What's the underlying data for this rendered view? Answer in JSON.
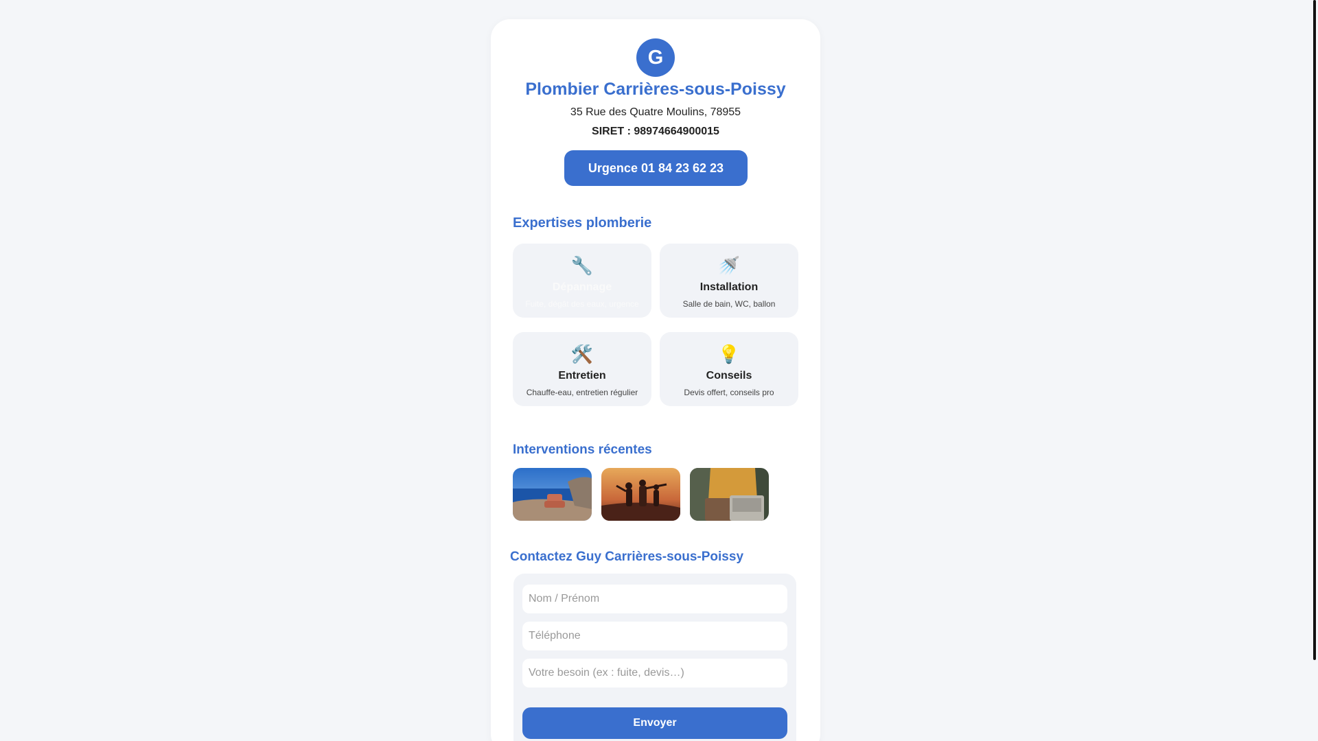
{
  "header": {
    "logo_letter": "G",
    "title": "Plombier Carrières-sous-Poissy",
    "address": "35 Rue des Quatre Moulins, 78955",
    "siret": "SIRET : 98974664900015",
    "urgent_button": "Urgence 01 84 23 62 23"
  },
  "services": {
    "section_title": "Expertises plomberie",
    "items": [
      {
        "icon": "wrench-icon",
        "glyph": "🔧",
        "name": "Dépannage",
        "desc": "Fuite, dégât des eaux, urgence"
      },
      {
        "icon": "shower-icon",
        "glyph": "🚿",
        "name": "Installation",
        "desc": "Salle de bain, WC, ballon"
      },
      {
        "icon": "tools-icon",
        "glyph": "🛠️",
        "name": "Entretien",
        "desc": "Chauffe-eau, entretien régulier"
      },
      {
        "icon": "lightbulb-icon",
        "glyph": "💡",
        "name": "Conseils",
        "desc": "Devis offert, conseils pro"
      }
    ]
  },
  "interventions": {
    "section_title": "Interventions récentes",
    "photos": [
      "photo-coast-chair",
      "photo-sunset-people",
      "photo-laptop"
    ]
  },
  "contact": {
    "section_title": "Contactez Guy Carrières-sous-Poissy",
    "name_placeholder": "Nom / Prénom",
    "phone_placeholder": "Téléphone",
    "need_placeholder": "Votre besoin (ex : fuite, devis…)",
    "send_button": "Envoyer"
  },
  "colors": {
    "accent": "#3a6fce",
    "background": "#f4f6f9",
    "card": "#ffffff",
    "tile": "#f1f3f7"
  }
}
